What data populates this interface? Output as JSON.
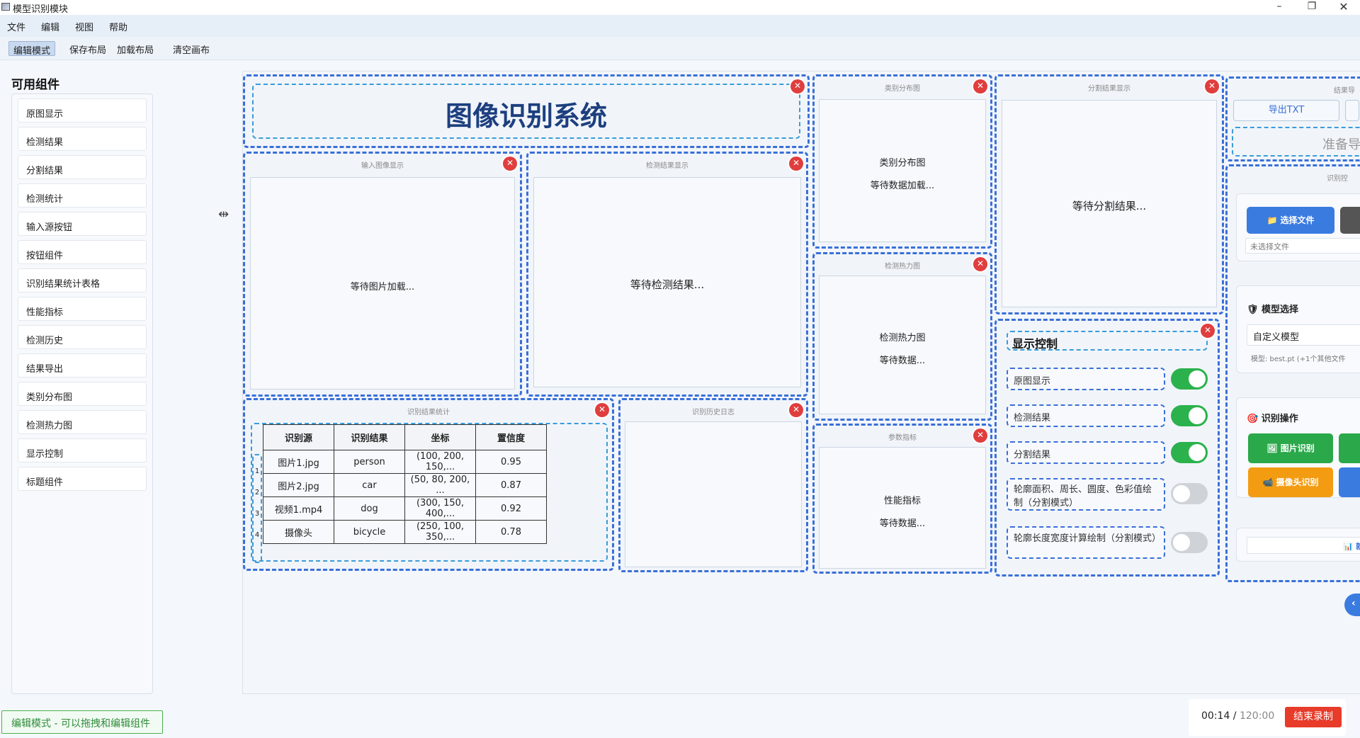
{
  "window": {
    "title": "模型识别模块",
    "minimize": "–",
    "restore": "❐",
    "close": "✕"
  },
  "menu": [
    "文件",
    "编辑",
    "视图",
    "帮助"
  ],
  "toolbar": {
    "edit_mode": "编辑模式",
    "save_layout": "保存布局",
    "load_layout": "加载布局",
    "clear_canvas": "清空画布"
  },
  "sidebar": {
    "title": "可用组件",
    "items": [
      "原图显示",
      "检测结果",
      "分割结果",
      "检测统计",
      "输入源按钮",
      "按钮组件",
      "识别结果统计表格",
      "性能指标",
      "检测历史",
      "结果导出",
      "类别分布图",
      "检测热力图",
      "显示控制",
      "标题组件"
    ]
  },
  "title_panel": {
    "text": "图像识别系统"
  },
  "input_panel": {
    "title": "输入图像显示",
    "placeholder": "等待图片加载..."
  },
  "detect_panel": {
    "title": "检测结果显示",
    "placeholder": "等待检测结果..."
  },
  "category_panel": {
    "title": "类别分布图",
    "line1": "类别分布图",
    "line2": "等待数据加载..."
  },
  "heatmap_panel": {
    "title": "检测热力图",
    "line1": "检测热力图",
    "line2": "等待数据..."
  },
  "metrics_panel": {
    "title": "参数指标",
    "line1": "性能指标",
    "line2": "等待数据..."
  },
  "seg_panel": {
    "title": "分割结果显示",
    "placeholder": "等待分割结果..."
  },
  "history_panel": {
    "title": "识别历史日志"
  },
  "stats_panel": {
    "title": "识别结果统计",
    "headers": [
      "识别源",
      "识别结果",
      "坐标",
      "置信度"
    ],
    "row_numbers": [
      "1",
      "2",
      "3",
      "4"
    ],
    "rows": [
      [
        "图片1.jpg",
        "person",
        "(100, 200, 150,...",
        "0.95"
      ],
      [
        "图片2.jpg",
        "car",
        "(50, 80, 200, ...",
        "0.87"
      ],
      [
        "视频1.mp4",
        "dog",
        "(300, 150, 400,...",
        "0.92"
      ],
      [
        "摄像头",
        "bicycle",
        "(250, 100, 350,...",
        "0.78"
      ]
    ]
  },
  "display_control": {
    "title": "显示控制",
    "items": [
      {
        "label": "原图显示",
        "on": true
      },
      {
        "label": "检测结果",
        "on": true
      },
      {
        "label": "分割结果",
        "on": true
      },
      {
        "label": "轮廓面积、周长、圆度、色彩值绘制（分割模式）",
        "on": false
      },
      {
        "label": "轮廓长度宽度计算绘制（分割模式）",
        "on": false
      }
    ]
  },
  "export_panel": {
    "title": "结果导",
    "export_txt": "导出TXT",
    "status": "准备导"
  },
  "right_col": {
    "section_title": "识别控",
    "choose_file": "📁 选择文件",
    "no_file": "未选择文件",
    "model_select": "🛡 模型选择",
    "model_value": "自定义模型",
    "model_hint": "模型: best.pt (+1个其他文件",
    "recognize_ops": "🎯 识别操作",
    "image_recognize": "🖼 图片识别",
    "camera_recognize": "📹 摄像头识别",
    "partial_button": "📊 就"
  },
  "status": {
    "badge": "编辑模式 - 可以拖拽和编辑组件"
  },
  "recording": {
    "elapsed": "00:14",
    "separator": " / ",
    "total": "120:00",
    "stop": "结束录制"
  },
  "colors": {
    "accent": "#3a6fd8",
    "close": "#e03e3e",
    "toggle_on": "#2bb24c",
    "primary_button": "#3a7be0",
    "green_button": "#2aa84a",
    "orange_button": "#f39c12",
    "stop_record": "#e83b2a"
  }
}
